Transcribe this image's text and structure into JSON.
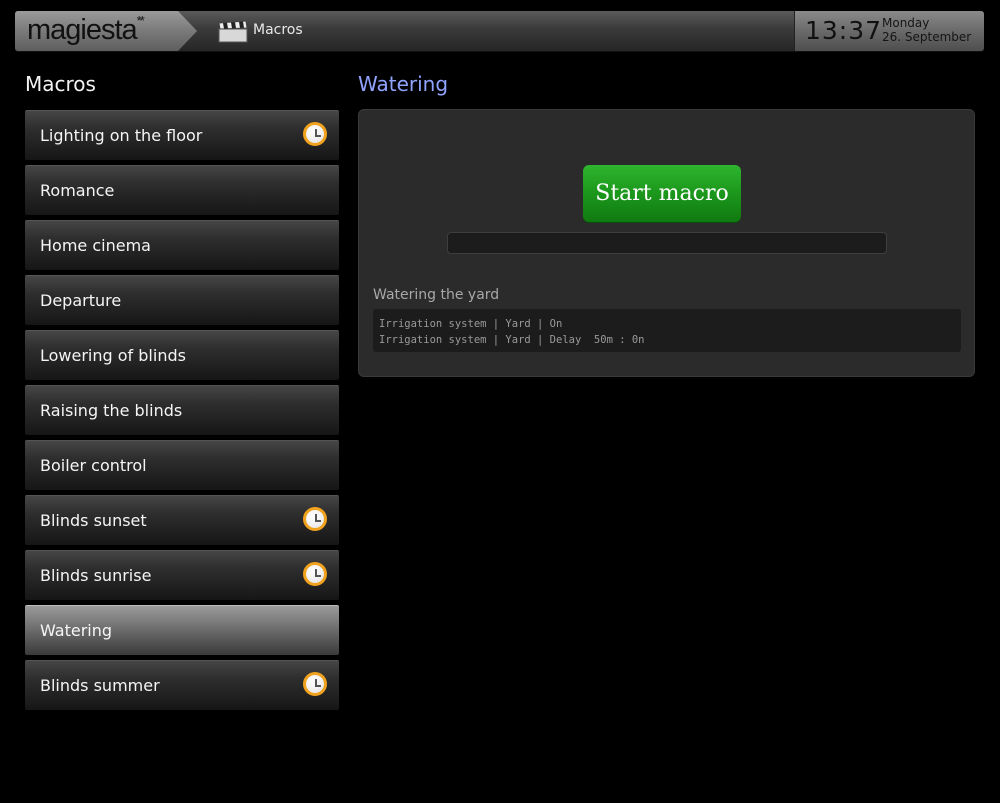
{
  "header": {
    "logo": "magiesta",
    "logo_mark": "**",
    "breadcrumb_icon": "clapperboard-icon",
    "breadcrumb_label": "Macros",
    "time": "13:37",
    "day": "Monday",
    "date": "26. September"
  },
  "sidebar": {
    "title": "Macros",
    "items": [
      {
        "label": "Lighting on the floor",
        "scheduled": true
      },
      {
        "label": "Romance",
        "scheduled": false
      },
      {
        "label": "Home cinema",
        "scheduled": false
      },
      {
        "label": "Departure",
        "scheduled": false
      },
      {
        "label": "Lowering of blinds",
        "scheduled": false
      },
      {
        "label": "Raising the blinds",
        "scheduled": false
      },
      {
        "label": "Boiler control",
        "scheduled": false
      },
      {
        "label": "Blinds sunset",
        "scheduled": true
      },
      {
        "label": "Blinds sunrise",
        "scheduled": true
      },
      {
        "label": "Watering",
        "scheduled": false,
        "active": true
      },
      {
        "label": "Blinds summer",
        "scheduled": true
      }
    ]
  },
  "main": {
    "title": "Watering",
    "start_button": "Start macro",
    "progress": 0,
    "description": "Watering the yard",
    "steps": [
      "Irrigation system | Yard | On",
      "Irrigation system | Yard | Delay  50m : 0n"
    ]
  },
  "colors": {
    "accent_title": "#8fa3ff",
    "start_button": "#1d9a1d",
    "schedule_icon": "#f0a21e"
  }
}
